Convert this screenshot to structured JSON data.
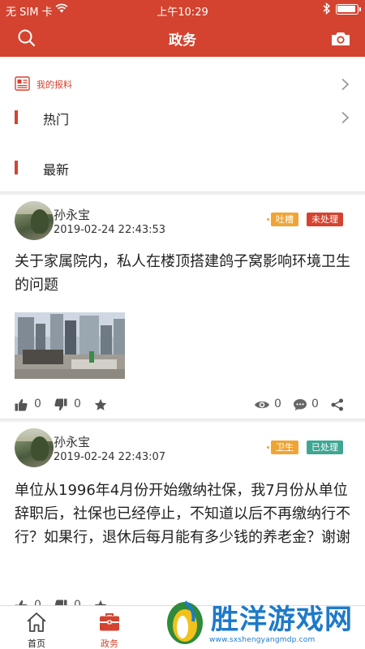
{
  "status_bar": {
    "carrier": "无 SIM 卡",
    "time": "上午10:29"
  },
  "nav": {
    "title": "政务",
    "icons": {
      "left": "search-icon",
      "right": "camera-icon"
    }
  },
  "my_report": {
    "label": "我的报料"
  },
  "sections": {
    "hot": "热门",
    "latest": "最新"
  },
  "posts": [
    {
      "author": "孙永宝",
      "date": "2019-02-24 22:43:53",
      "topic_tag": "吐槽",
      "status_tag": "未处理",
      "text": "关于家属院内，私人在楼顶搭建鸽子窝影响环境卫生的问题",
      "likes": "0",
      "dislikes": "0",
      "views": "0",
      "comments": "0"
    },
    {
      "author": "孙永宝",
      "date": "2019-02-24 22:43:07",
      "topic_tag": "卫生",
      "status_tag": "已处理",
      "text": "单位从1996年4月份开始缴纳社保，我7月份从单位辞职后，社保也已经停止，不知道以后不再缴纳行不行？如果行，退休后每月能有多少钱的养老金？谢谢",
      "likes": "0",
      "dislikes": "0"
    }
  ],
  "tab_bar": {
    "home": "首页",
    "gov": "政务"
  },
  "colors": {
    "brand": "#d4432f",
    "tag_orange": "#efa536",
    "tag_green": "#3ea693",
    "watermark_blue": "#1e7ac9"
  },
  "watermark": {
    "text": "胜洋游戏网",
    "url": "www.sxshengyangmdp.com"
  }
}
